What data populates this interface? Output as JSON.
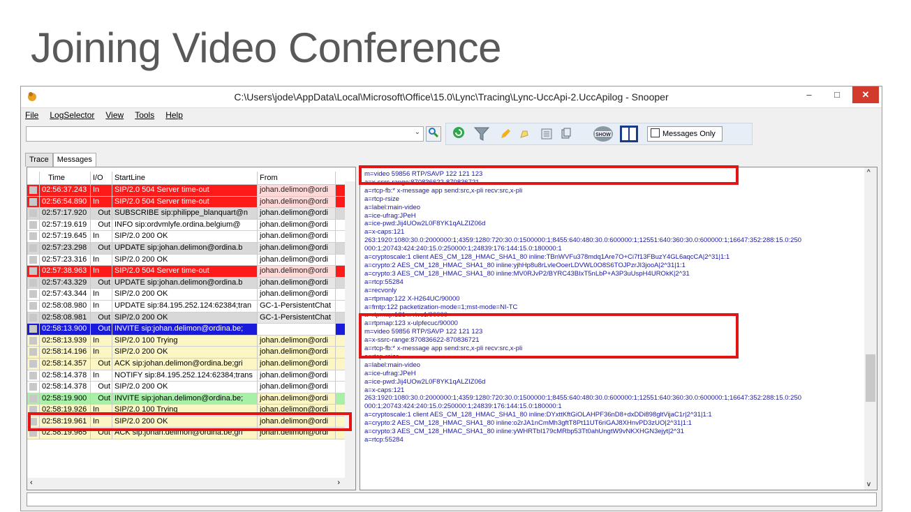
{
  "slide": {
    "title": "Joining Video Conference"
  },
  "window": {
    "title": "C:\\Users\\jode\\AppData\\Local\\Microsoft\\Office\\15.0\\Lync\\Tracing\\Lync-UccApi-2.UccApilog - Snooper",
    "min_label": "–",
    "max_label": "□",
    "close_label": "✕"
  },
  "menu": {
    "file": "File",
    "logselector": "LogSelector",
    "view": "View",
    "tools": "Tools",
    "help": "Help"
  },
  "toolbar": {
    "search_value": "",
    "messages_only_label": "Messages Only"
  },
  "tabs": {
    "trace": "Trace",
    "messages": "Messages"
  },
  "grid": {
    "headers": {
      "time": "Time",
      "io": "I/O",
      "startline": "StartLine",
      "from": "From"
    },
    "rows": [
      {
        "time": "02:56:37.243",
        "io": "In",
        "start": "SIP/2.0 504 Server time-out",
        "from": "johan.delimon@ordi",
        "style": "red"
      },
      {
        "time": "02:56:54.890",
        "io": "In",
        "start": "SIP/2.0 504 Server time-out",
        "from": "johan.delimon@ordi",
        "style": "red"
      },
      {
        "time": "02:57:17.920",
        "io": "Out",
        "start": "SUBSCRIBE sip:philippe_blanquart@n",
        "from": "johan.delimon@ordi",
        "style": "gray"
      },
      {
        "time": "02:57:19.619",
        "io": "Out",
        "start": "INFO sip:ordvmlyfe.ordina.belgium@",
        "from": "johan.delimon@ordi",
        "style": "white"
      },
      {
        "time": "02:57:19.645",
        "io": "In",
        "start": "SIP/2.0 200 OK",
        "from": "johan.delimon@ordi",
        "style": "white"
      },
      {
        "time": "02:57:23.298",
        "io": "Out",
        "start": "UPDATE sip:johan.delimon@ordina.b",
        "from": "johan.delimon@ordi",
        "style": "gray"
      },
      {
        "time": "02:57:23.316",
        "io": "In",
        "start": "SIP/2.0 200 OK",
        "from": "johan.delimon@ordi",
        "style": "white"
      },
      {
        "time": "02:57:38.963",
        "io": "In",
        "start": "SIP/2.0 504 Server time-out",
        "from": "johan.delimon@ordi",
        "style": "red"
      },
      {
        "time": "02:57:43.329",
        "io": "Out",
        "start": "UPDATE sip:johan.delimon@ordina.b",
        "from": "johan.delimon@ordi",
        "style": "gray"
      },
      {
        "time": "02:57:43.344",
        "io": "In",
        "start": "SIP/2.0 200 OK",
        "from": "johan.delimon@ordi",
        "style": "white"
      },
      {
        "time": "02:58:08.980",
        "io": "In",
        "start": "UPDATE sip:84.195.252.124:62384;tran",
        "from": "GC-1-PersistentChat",
        "style": "white"
      },
      {
        "time": "02:58:08.981",
        "io": "Out",
        "start": "SIP/2.0 200 OK",
        "from": "GC-1-PersistentChat",
        "style": "gray"
      },
      {
        "time": "02:58:13.900",
        "io": "Out",
        "start": "INVITE sip:johan.delimon@ordina.be;",
        "from": "johan.delimon@ordi",
        "style": "blue"
      },
      {
        "time": "02:58:13.939",
        "io": "In",
        "start": "SIP/2.0 100 Trying",
        "from": "johan.delimon@ordi",
        "style": "yellow"
      },
      {
        "time": "02:58:14.196",
        "io": "In",
        "start": "SIP/2.0 200 OK",
        "from": "johan.delimon@ordi",
        "style": "yellow"
      },
      {
        "time": "02:58:14.357",
        "io": "Out",
        "start": "ACK sip:johan.delimon@ordina.be;gri",
        "from": "johan.delimon@ordi",
        "style": "yellow"
      },
      {
        "time": "02:58:14.378",
        "io": "In",
        "start": "NOTIFY sip:84.195.252.124:62384;trans",
        "from": "johan.delimon@ordi",
        "style": "white"
      },
      {
        "time": "02:58:14.378",
        "io": "Out",
        "start": "SIP/2.0 200 OK",
        "from": "johan.delimon@ordi",
        "style": "white"
      },
      {
        "time": "02:58:19.900",
        "io": "Out",
        "start": "INVITE sip:johan.delimon@ordina.be;",
        "from": "johan.delimon@ordi",
        "style": "green"
      },
      {
        "time": "02:58:19.926",
        "io": "In",
        "start": "SIP/2.0 100 Trying",
        "from": "johan.delimon@ordi",
        "style": "yellow"
      },
      {
        "time": "02:58:19.961",
        "io": "In",
        "start": "SIP/2.0 200 OK",
        "from": "johan.delimon@ordi",
        "style": "yellow"
      },
      {
        "time": "02:58:19.965",
        "io": "Out",
        "start": "ACK sip:johan.delimon@ordina.be;gri",
        "from": "johan.delimon@ordi",
        "style": "yellow"
      }
    ]
  },
  "sdp_lines": [
    "m=video 59856 RTP/SAVP 122 121 123",
    "a=x-ssrc-range:870836622-870836721",
    "a=rtcp-fb:* x-message app send:src,x-pli recv:src,x-pli",
    "a=rtcp-rsize",
    "a=label:main-video",
    "a=ice-ufrag:JPeH",
    "a=ice-pwd:Jij4UOw2L0F8YK1qALZIZ06d",
    "a=x-caps:121",
    "263:1920:1080:30.0:2000000:1;4359:1280:720:30.0:1500000:1;8455:640:480:30.0:600000:1;12551:640:360:30.0:600000:1;16647:352:288:15.0:250",
    "000:1;20743:424:240:15.0:250000:1;24839:176:144:15.0:180000:1",
    "a=cryptoscale:1 client AES_CM_128_HMAC_SHA1_80 inline:TBnWVFu378mdq1Are7O+Ci7f13FBuzY4GL6aqcCA|2^31|1:1",
    "a=crypto:2 AES_CM_128_HMAC_SHA1_80 inline:yjhHp8u8rLvleOoerLDVWL0O8S6TOJPzrJI3jooA|2^31|1:1",
    "a=crypto:3 AES_CM_128_HMAC_SHA1_80 inline:MV0RJvP2/BYRC43BIxT5nLbP+A3P3uUspH4UROkK|2^31",
    "a=rtcp:55284",
    "a=recvonly",
    "a=rtpmap:122 X-H264UC/90000",
    "a=fmtp:122 packetization-mode=1;mst-mode=NI-TC",
    "a=rtpmap:121 x-rtvc1/90000",
    "a=rtpmap:123 x-ulpfecuc/90000",
    "m=video 59856 RTP/SAVP 122 121 123",
    "a=x-ssrc-range:870836622-870836721",
    "a=rtcp-fb:* x-message app send:src,x-pli recv:src,x-pli",
    "a=rtcp-rsize",
    "a=label:main-video",
    "a=ice-ufrag:JPeH",
    "a=ice-pwd:Jij4UOw2L0F8YK1qALZIZ06d",
    "a=x-caps:121",
    "263:1920:1080:30.0:2000000:1;4359:1280:720:30.0:1500000:1;8455:640:480:30.0:600000:1;12551:640:360:30.0:600000:1;16647:352:288:15.0:250",
    "000:1;20743:424:240:15.0:250000:1;24839:176:144:15.0:180000:1",
    "a=cryptoscale:1 client AES_CM_128_HMAC_SHA1_80 inline:DYxttKftGiOLAHPF36nD8+dxDDi898gltVijaC1r|2^31|1:1",
    "a=crypto:2 AES_CM_128_HMAC_SHA1_80 inline:o2rJA1nCmMh3gftT8Pt11UT6riGAJ8XHnvPD3zUO|2^31|1:1",
    "a=crypto:3 AES_CM_128_HMAC_SHA1_80 inline:yWHRTbI179cMRbp53Tt0ahUngtW9vNKXHGN3ejyt|2^31",
    "a=rtcp:55284"
  ],
  "colors": {
    "highlight": "#e01515",
    "sdp_text": "#1a1aa0",
    "error_row": "#ff1a1a"
  }
}
